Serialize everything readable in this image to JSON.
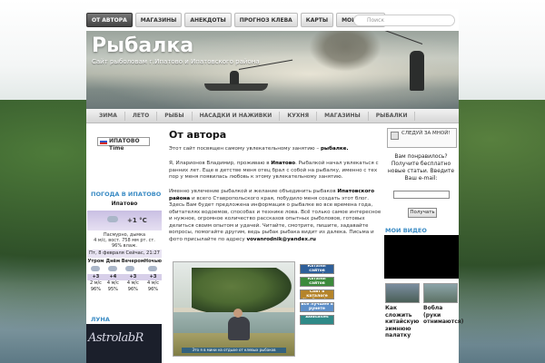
{
  "nav": {
    "items": [
      "ОТ АВТОРА",
      "МАГАЗИНЫ",
      "АНЕКДОТЫ",
      "ПРОГНОЗ КЛЕВА",
      "КАРТЫ",
      "МОИ ВИДЕО"
    ],
    "active_index": 0
  },
  "search": {
    "placeholder": "Поиск"
  },
  "header": {
    "title": "Рыбалка",
    "subtitle": "Сайт рыболовам г.Ипатово и Ипатовского района"
  },
  "categories": [
    "ЗИМА",
    "ЛЕТО",
    "РЫБЫ",
    "НАСАДКИ И НАЖИВКИ",
    "КУХНЯ",
    "МАГАЗИНЫ",
    "РЫБАЛКИ"
  ],
  "left": {
    "time_label": "ИПАТОВО Time",
    "weather_heading": "ПОГОДА В ИПАТОВО",
    "weather": {
      "city": "Ипатово",
      "temp_now": "+1 °C",
      "desc_line1": "Пасмурно, дымка",
      "desc_line2": "4 м/с, вост. 758 мм рт. ст.",
      "desc_line3": "96% влаж.",
      "date": "Пт, 8 февраля",
      "date_now": "Сейчас, 21:27",
      "periods": [
        "Утром",
        "Днём",
        "Вечером",
        "Ночью"
      ],
      "temps": [
        "+3",
        "+4",
        "+3",
        "+3"
      ],
      "winds": [
        "2 м/с",
        "4 м/с",
        "4 м/с",
        "4 м/с"
      ],
      "humidity": [
        "96%",
        "95%",
        "96%",
        "96%"
      ]
    },
    "luna_heading": "ЛУНА",
    "luna_text": "AstrolabR"
  },
  "content": {
    "title": "От автора",
    "intro_pre": "Этот сайт посвящен самому увлекательному занятию –",
    "intro_bold": "рыбалке.",
    "p2_a": "Я, Иларионов Владимир, проживаю в",
    "p2_bold": "Ипатово",
    "p2_b": ". Рыбалкой начал увлекаться с ранних лет. Еще в детстве меня отец брал с собой на рыбалку, именно с тех пор у меня появилась любовь к этому увлекательному занятию.",
    "p3_a": "Именно увлечение рыбалкой и желание объединить рыбаков",
    "p3_bold": "Ипатовского района",
    "p3_b": "и всего Ставропольского края, побудило меня создать этот блог. Здесь Вам будет предложена информация о рыбалке во все времена года, обитателях водоемов, способах и технике лова. Всё только самое интересное и нужное, огромное количество рассказов опытных рыболовов, готовых делиться своим опытом и удачей. Читайте, смотрите, пишите, задавайте вопросы, помогайте другим, ведь рыбак рыбака видит из далека. Письма и фото присылайте по адресу",
    "email": "vovanrodnik@yandex.ru",
    "photo_caption": "Это я в мини на отдыхе от клевых рыбаков",
    "badges": [
      "Каталог сайтов manyvrob.ru",
      "Каталог сайтов",
      "Сайт в каталоге GlavBoard.ru",
      "Всё лучшее в рунете",
      "AddsSites"
    ]
  },
  "right": {
    "follow": "СЛЕДУЙ ЗА МНОЙ!",
    "subscribe": "Вам понравилось? Получите бесплатно новые статьи. Введите Ваш e-mail:",
    "subscribe_btn": "Получать",
    "video_heading": "МОИ ВИДЕО",
    "videos": [
      "Как сложить китайскую зимнюю палатку",
      "Вобла (руки отнимаются)"
    ]
  },
  "colors": {
    "accent": "#3a8bc4",
    "nav_active": "#555555"
  }
}
